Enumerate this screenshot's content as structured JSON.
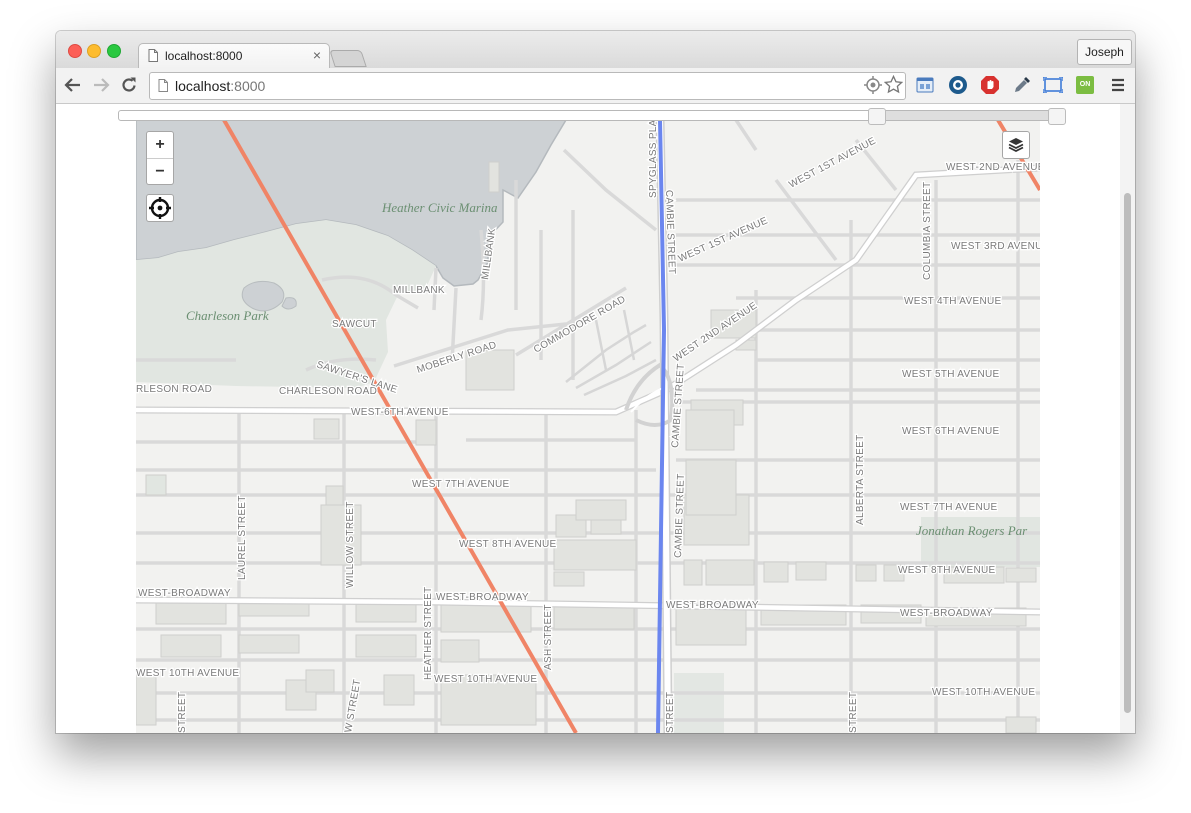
{
  "browser": {
    "tab_title": "localhost:8000",
    "tab_close": "×",
    "url_host": "localhost",
    "url_port": ":8000",
    "profile_name": "Joseph",
    "extension_badge": "ON"
  },
  "map": {
    "zoom_in": "+",
    "zoom_out": "−",
    "parks": [
      "Heather Civic Marina",
      "Charleson Park",
      "Jonathan Rogers Par"
    ],
    "avenues": {
      "w1st_a": "WEST 1ST AVENUE",
      "w1st_b": "WEST 1ST AVENUE",
      "w2nd_a": "WEST-2ND AVENUE",
      "w2nd_b": "WEST 2ND AVENUE",
      "w3rd": "WEST 3RD AVENUE",
      "w4th": "WEST 4TH AVENUE",
      "w5th": "WEST 5TH AVENUE",
      "w6th_a": "WEST-6TH AVENUE",
      "w6th_b": "WEST 6TH AVENUE",
      "w7th_a": "WEST 7TH AVENUE",
      "w7th_b": "WEST 7TH AVENUE",
      "w8th_a": "WEST 8TH AVENUE",
      "w8th_b": "WEST 8TH AVENUE",
      "bw_a": "WEST-BROADWAY",
      "bw_b": "WEST-BROADWAY",
      "bw_c": "WEST-BROADWAY",
      "bw_d": "WEST-BROADWAY",
      "w10th_a": "WEST 10TH AVENUE",
      "w10th_b": "WEST 10TH AVENUE",
      "w10th_c": "WEST 10TH AVENUE"
    },
    "streets": {
      "spyglass": "SPYGLASS PLA",
      "cambie_a": "CAMBIE STREET",
      "cambie_b": "CAMBIE STREET",
      "cambie_c": "CAMBIE STREET",
      "cambie_d": "STREET",
      "millbank_v": "MILLBANK",
      "millbank_h": "MILLBANK",
      "sawcut": "SAWCUT",
      "sawyers": "SAWYER'S LANE",
      "moberly": "MOBERLY ROAD",
      "commodore": "COMMODORE ROAD",
      "charleson_a": "RLESON ROAD",
      "charleson_b": "CHARLESON ROAD",
      "columbia": "COLUMBIA STREET",
      "alberta": "ALBERTA STREET",
      "laurel": "LAUREL STREET",
      "willow": "WILLOW STREET",
      "heather": "HEATHER STREET",
      "ash": "ASH STREET",
      "street_a": "STREET",
      "street_b": "W STREET",
      "street_c": "STREET"
    }
  },
  "colors": {
    "water": "#cdd1d4",
    "land": "#f2f2f0",
    "park": "#e1e6e1",
    "route_red": "#f08466",
    "route_blue": "#6b86ef"
  }
}
